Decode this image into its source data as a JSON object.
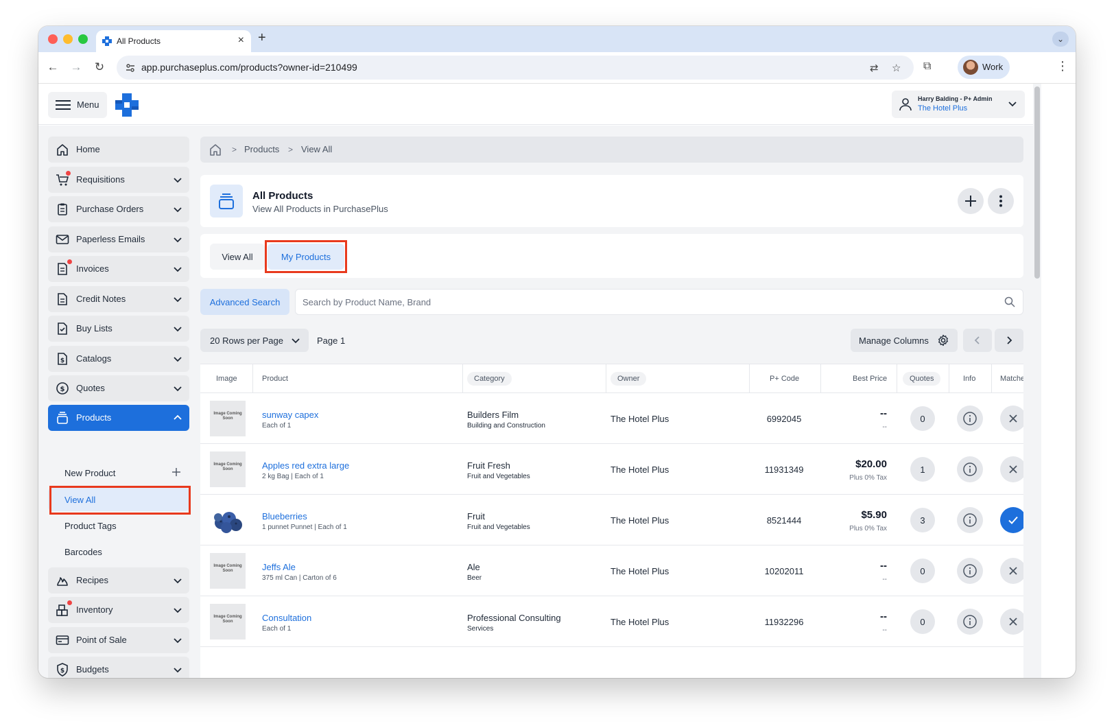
{
  "browser": {
    "tab_title": "All Products",
    "url": "app.purchaseplus.com/products?owner-id=210499",
    "profile": "Work",
    "new_tab": "+",
    "close_tab": "×"
  },
  "header": {
    "menu_label": "Menu",
    "user_name": "Harry Balding - P+ Admin",
    "user_org": "The Hotel Plus"
  },
  "sidebar": {
    "items": [
      {
        "label": "Home",
        "icon": "home-icon",
        "has_chevron": false,
        "dot": false
      },
      {
        "label": "Requisitions",
        "icon": "cart-icon",
        "has_chevron": true,
        "dot": true
      },
      {
        "label": "Purchase Orders",
        "icon": "clipboard-icon",
        "has_chevron": true,
        "dot": false
      },
      {
        "label": "Paperless Emails",
        "icon": "envelope-icon",
        "has_chevron": true,
        "dot": false
      },
      {
        "label": "Invoices",
        "icon": "invoice-icon",
        "has_chevron": true,
        "dot": true
      },
      {
        "label": "Credit Notes",
        "icon": "document-icon",
        "has_chevron": true,
        "dot": false
      },
      {
        "label": "Buy Lists",
        "icon": "checklist-icon",
        "has_chevron": true,
        "dot": false
      },
      {
        "label": "Catalogs",
        "icon": "catalog-icon",
        "has_chevron": true,
        "dot": false
      },
      {
        "label": "Quotes",
        "icon": "dollar-circle-icon",
        "has_chevron": true,
        "dot": false
      },
      {
        "label": "Products",
        "icon": "products-icon",
        "has_chevron": true,
        "dot": false,
        "active": true
      }
    ],
    "products_submenu": [
      {
        "label": "New Product",
        "has_plus": true
      },
      {
        "label": "View All",
        "current": true
      },
      {
        "label": "Product Tags"
      },
      {
        "label": "Barcodes"
      }
    ],
    "items_after": [
      {
        "label": "Recipes",
        "icon": "flame-icon",
        "dot": false
      },
      {
        "label": "Inventory",
        "icon": "boxes-icon",
        "dot": true
      },
      {
        "label": "Point of Sale",
        "icon": "card-icon",
        "dot": false
      },
      {
        "label": "Budgets",
        "icon": "shield-dollar-icon",
        "dot": false
      }
    ]
  },
  "breadcrumb": {
    "items": [
      "Products",
      "View All"
    ],
    "separator": ">"
  },
  "page": {
    "title": "All Products",
    "subtitle": "View All Products in PurchasePlus"
  },
  "tabs": [
    "View All",
    "My Products"
  ],
  "search": {
    "advanced_label": "Advanced Search",
    "placeholder": "Search by Product Name, Brand"
  },
  "controls": {
    "rows_label": "20 Rows per Page",
    "page_label": "Page 1",
    "manage_columns": "Manage Columns"
  },
  "table": {
    "columns": [
      "Image",
      "Product",
      "Category",
      "Owner",
      "P+ Code",
      "Best Price",
      "Quotes",
      "Info",
      "Matche"
    ],
    "placeholder_image_text": "Image Coming Soon",
    "rows": [
      {
        "name": "sunway capex",
        "unit": "Each of 1",
        "category": "Builders Film",
        "subcategory": "Building and Construction",
        "owner": "The Hotel Plus",
        "code": "6992045",
        "price": "--",
        "price_sub": "--",
        "quotes": "0",
        "matched": false,
        "image": "placeholder"
      },
      {
        "name": "Apples red extra large",
        "unit": "2 kg Bag | Each of 1",
        "category": "Fruit Fresh",
        "subcategory": "Fruit and Vegetables",
        "owner": "The Hotel Plus",
        "code": "11931349",
        "price": "$20.00",
        "price_sub": "Plus 0% Tax",
        "quotes": "1",
        "matched": false,
        "image": "placeholder"
      },
      {
        "name": "Blueberries",
        "unit": "1 punnet Punnet | Each of 1",
        "category": "Fruit",
        "subcategory": "Fruit and Vegetables",
        "owner": "The Hotel Plus",
        "code": "8521444",
        "price": "$5.90",
        "price_sub": "Plus 0% Tax",
        "quotes": "3",
        "matched": true,
        "image": "blueberries"
      },
      {
        "name": "Jeffs Ale",
        "unit": "375 ml Can | Carton of 6",
        "category": "Ale",
        "subcategory": "Beer",
        "owner": "The Hotel Plus",
        "code": "10202011",
        "price": "--",
        "price_sub": "--",
        "quotes": "0",
        "matched": false,
        "image": "placeholder"
      },
      {
        "name": "Consultation",
        "unit": "Each of 1",
        "category": "Professional Consulting",
        "subcategory": "Services",
        "owner": "The Hotel Plus",
        "code": "11932296",
        "price": "--",
        "price_sub": "--",
        "quotes": "0",
        "matched": false,
        "image": "placeholder"
      }
    ]
  },
  "colors": {
    "accent": "#1d6fdc",
    "highlight_box": "#e8391d",
    "notification_dot": "#ef4444"
  }
}
